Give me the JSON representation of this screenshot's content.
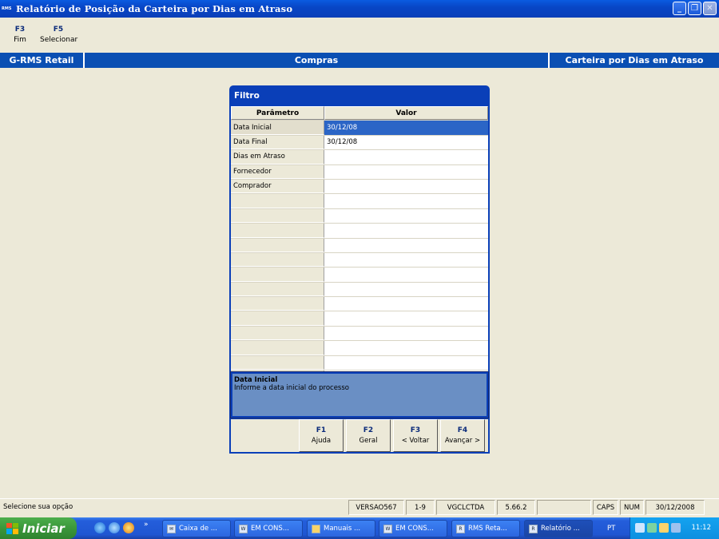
{
  "window": {
    "title": "Relatório de Posição da Carteira por Dias em Atraso",
    "logo": "RMS"
  },
  "toolbar": [
    {
      "key": "F3",
      "label": "Fim"
    },
    {
      "key": "F5",
      "label": "Selecionar"
    }
  ],
  "header": {
    "app": "G-RMS Retail",
    "module": "Compras",
    "report": "Carteira por Dias em Atraso"
  },
  "filter": {
    "title": "Filtro",
    "col_param": "Parâmetro",
    "col_value": "Valor",
    "rows": [
      {
        "param": "Data Inicial",
        "value": "30/12/08"
      },
      {
        "param": "Data Final",
        "value": "30/12/08"
      },
      {
        "param": "Dias em Atraso",
        "value": ""
      },
      {
        "param": "Fornecedor",
        "value": ""
      },
      {
        "param": "Comprador",
        "value": ""
      }
    ],
    "help_title": "Data Inicial",
    "help_text": "Informe a data inicial do processo",
    "buttons": [
      {
        "key": "F1",
        "label": "Ajuda"
      },
      {
        "key": "F2",
        "label": "Geral"
      },
      {
        "key": "F3",
        "label": "< Voltar"
      },
      {
        "key": "F4",
        "label": "Avançar >"
      }
    ]
  },
  "status": {
    "message": "Selecione sua opção",
    "cells": [
      "VERSAO567",
      "1-9",
      "VGCLCTDA",
      "5.66.2",
      "",
      "CAPS",
      "NUM",
      "30/12/2008"
    ]
  },
  "taskbar": {
    "start": "Iniciar",
    "more": "»",
    "items": [
      "Caixa de ...",
      "EM CONS...",
      "Manuais ...",
      "EM CONS...",
      "RMS Reta...",
      "Relatório ..."
    ],
    "lang": "PT",
    "clock": "11:12"
  }
}
